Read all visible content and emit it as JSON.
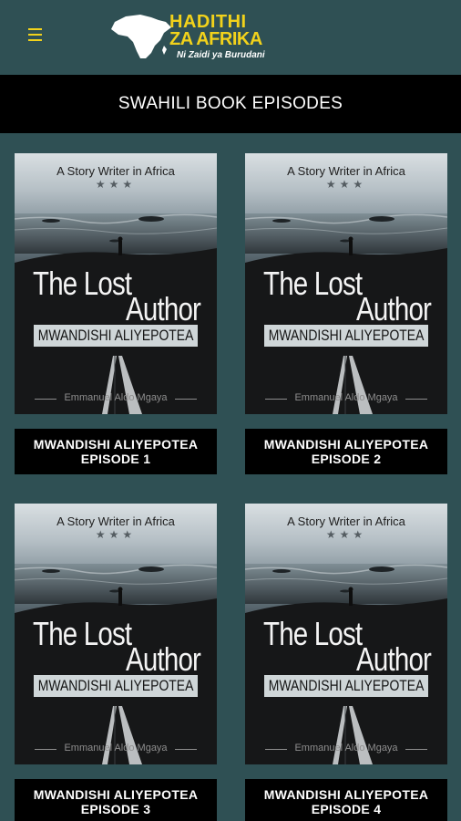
{
  "app": {
    "logo": {
      "line1": "HADITHI",
      "line2": "ZA AFRIKA",
      "tagline": "Ni Zaidi ya Burudani"
    },
    "menu_icon": "hamburger-menu-icon"
  },
  "section": {
    "title": "SWAHILI BOOK EPISODES"
  },
  "colors": {
    "background": "#2f5054",
    "header": "#000000",
    "accent": "#f2d21b"
  },
  "episodes": [
    {
      "cover": {
        "top_text": "A Story Writer in Africa",
        "stars": "★★★",
        "title_line1": "The Lost",
        "title_line2": "Author",
        "band": "MWANDISHI ALIYEPOTEA",
        "author": "Emmanuel Aldo Mgaya"
      },
      "caption_line1": "MWANDISHI ALIYEPOTEA",
      "caption_line2": "EPISODE 1"
    },
    {
      "cover": {
        "top_text": "A Story Writer in Africa",
        "stars": "★★★",
        "title_line1": "The Lost",
        "title_line2": "Author",
        "band": "MWANDISHI ALIYEPOTEA",
        "author": "Emmanuel Aldo Mgaya"
      },
      "caption_line1": "MWANDISHI ALIYEPOTEA",
      "caption_line2": "EPISODE 2"
    },
    {
      "cover": {
        "top_text": "A Story Writer in Africa",
        "stars": "★★★",
        "title_line1": "The Lost",
        "title_line2": "Author",
        "band": "MWANDISHI ALIYEPOTEA",
        "author": "Emmanuel Aldo Mgaya"
      },
      "caption_line1": "MWANDISHI ALIYEPOTEA",
      "caption_line2": "EPISODE 3"
    },
    {
      "cover": {
        "top_text": "A Story Writer in Africa",
        "stars": "★★★",
        "title_line1": "The Lost",
        "title_line2": "Author",
        "band": "MWANDISHI ALIYEPOTEA",
        "author": "Emmanuel Aldo Mgaya"
      },
      "caption_line1": "MWANDISHI ALIYEPOTEA",
      "caption_line2": "EPISODE 4"
    }
  ]
}
